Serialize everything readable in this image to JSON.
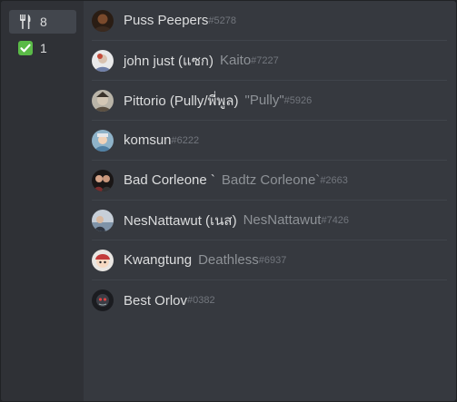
{
  "tabs": [
    {
      "icon": "fork-knife-icon",
      "count": "8"
    },
    {
      "icon": "check-mark-icon",
      "count": "1"
    }
  ],
  "members": [
    {
      "name": "Puss Peepers",
      "nick": "",
      "tag": "#5278"
    },
    {
      "name": "john just (แซก)",
      "nick": "Kaito",
      "tag": "#7227"
    },
    {
      "name": "Pittorio (Pully/พี่พูล)",
      "nick": "\"Pully\"",
      "tag": "#5926"
    },
    {
      "name": "komsun",
      "nick": "",
      "tag": "#6222"
    },
    {
      "name": "Bad Corleone `",
      "nick": "Badtz Corleone`",
      "tag": "#2663"
    },
    {
      "name": "NesNattawut (เนส)",
      "nick": "NesNattawut",
      "tag": "#7426"
    },
    {
      "name": "Kwangtung",
      "nick": "Deathless",
      "tag": "#6937"
    },
    {
      "name": "Best Orlov",
      "nick": "",
      "tag": "#0382"
    }
  ]
}
